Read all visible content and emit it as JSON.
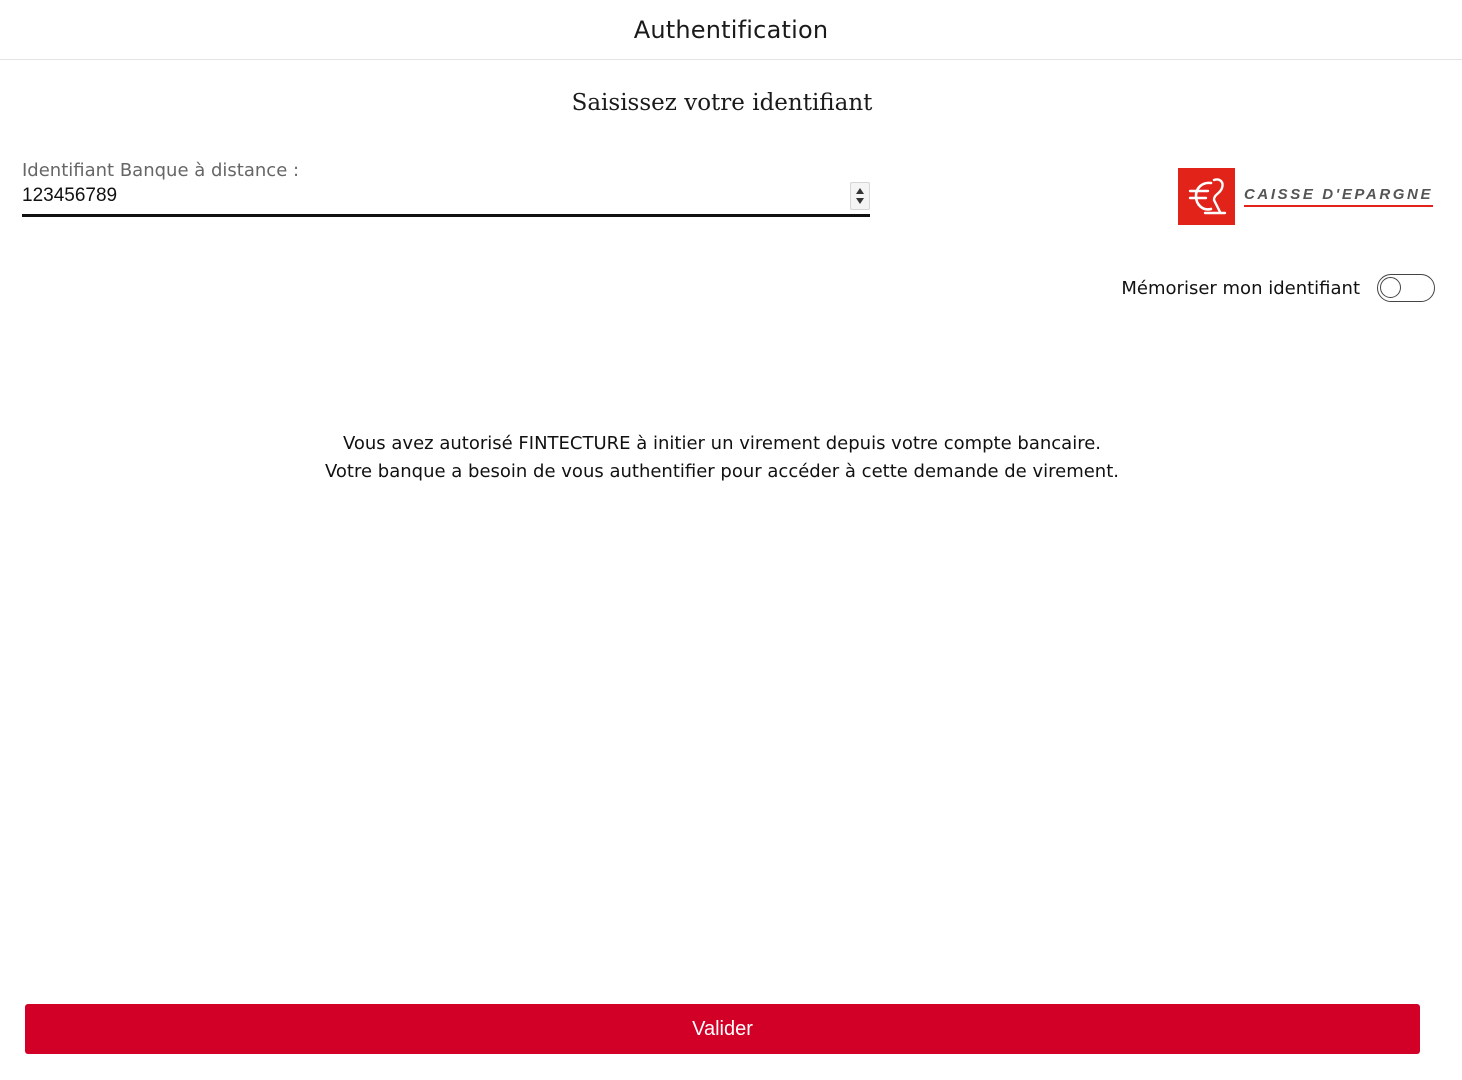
{
  "header": {
    "title": "Authentification"
  },
  "form": {
    "subtitle": "Saisissez votre identifiant",
    "identifier_label": "Identifiant Banque à distance :",
    "identifier_value": "123456789",
    "remember_label": "Mémoriser mon identifiant",
    "remember_checked": false
  },
  "bank": {
    "name": "CAISSE D'EPARGNE",
    "brand_color": "#e2231a",
    "logo_icon": "caisse-epargne-squirrel-logo"
  },
  "info": {
    "line1": "Vous avez autorisé FINTECTURE à initier un virement depuis votre compte bancaire.",
    "line2": "Votre banque a besoin de vous authentifier pour accéder à cette demande de virement."
  },
  "actions": {
    "submit_label": "Valider",
    "submit_color": "#d20027"
  }
}
